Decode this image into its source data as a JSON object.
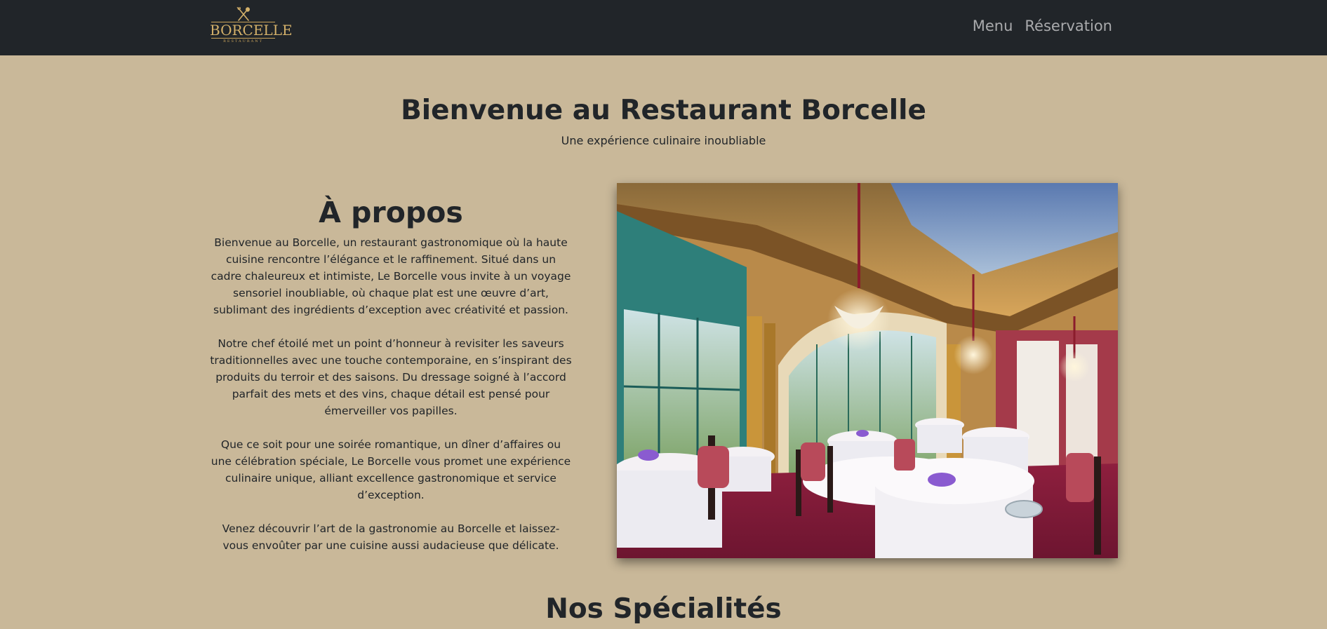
{
  "navbar": {
    "logo": {
      "word": "BORCELLE",
      "sub": "RESTAURANT"
    },
    "links": [
      "Menu",
      "Réservation"
    ]
  },
  "hero": {
    "title": "Bienvenue au Restaurant Borcelle",
    "subtitle": "Une expérience culinaire inoubliable"
  },
  "about": {
    "title": "À propos",
    "paragraphs": [
      "Bienvenue au Borcelle, un restaurant gastronomique où la haute cuisine rencontre l’élégance et le raffinement. Situé dans un cadre chaleureux et intimiste, Le Borcelle vous invite à un voyage sensoriel inoubliable, où chaque plat est une œuvre d’art, sublimant des ingrédients d’exception avec créativité et passion.",
      "Notre chef étoilé met un point d’honneur à revisiter les saveurs traditionnelles avec une touche contemporaine, en s’inspirant des produits du terroir et des saisons. Du dressage soigné à l’accord parfait des mets et des vins, chaque détail est pensé pour émerveiller vos papilles.",
      "Que ce soit pour une soirée romantique, un dîner d’affaires ou une célébration spéciale, Le Borcelle vous promet une expérience culinaire unique, alliant excellence gastronomique et service d’exception.",
      "Venez découvrir l’art de la gastronomie au Borcelle et laissez-vous envoûter par une cuisine aussi audacieuse que délicate."
    ]
  },
  "specialties": {
    "title": "Nos Spécialités"
  },
  "colors": {
    "background": "#c9b899",
    "navbar": "#212529",
    "nav_link": "#a9aaac",
    "logo_gold": "#c9a35a",
    "text": "#212529"
  },
  "icons": {
    "logo": "crossed-fork-spoon-icon"
  }
}
